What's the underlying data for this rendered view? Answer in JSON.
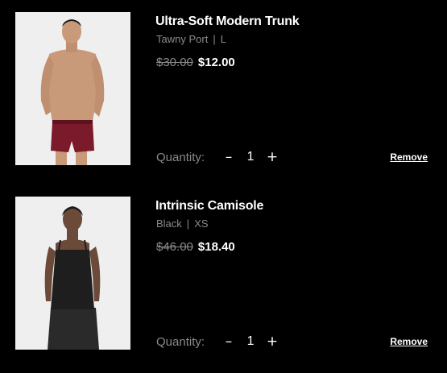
{
  "cart": {
    "items": [
      {
        "name": "Ultra-Soft Modern Trunk",
        "color": "Tawny Port",
        "separator": "|",
        "size": "L",
        "original_price": "$30.00",
        "sale_price": "$12.00",
        "quantity_label": "Quantity:",
        "decrement_label": "–",
        "quantity": "1",
        "increment_label": "+",
        "remove_label": "Remove",
        "image_icon": "product-photo-model-trunk"
      },
      {
        "name": "Intrinsic Camisole",
        "color": "Black",
        "separator": "|",
        "size": "XS",
        "original_price": "$46.00",
        "sale_price": "$18.40",
        "quantity_label": "Quantity:",
        "decrement_label": "–",
        "quantity": "1",
        "increment_label": "+",
        "remove_label": "Remove",
        "image_icon": "product-photo-model-camisole"
      }
    ]
  },
  "colors": {
    "background": "#000000",
    "text": "#ffffff",
    "muted": "#8a8a8a",
    "photo_background": "#eeeeee",
    "trunk_color": "#7a1a2a"
  }
}
